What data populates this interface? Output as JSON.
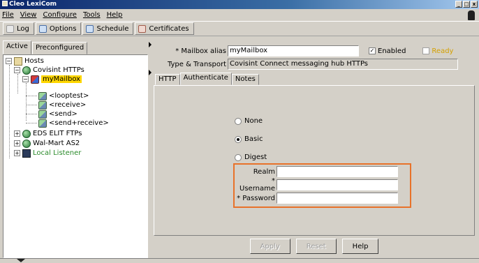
{
  "window": {
    "title": "Cleo LexiCom",
    "min": "_",
    "max": "□",
    "close": "x"
  },
  "menu": [
    "File",
    "View",
    "Configure",
    "Tools",
    "Help"
  ],
  "toolbar": {
    "log": "Log",
    "options": "Options",
    "schedule": "Schedule",
    "certificates": "Certificates"
  },
  "left_tabs": {
    "active": "Active",
    "preconfigured": "Preconfigured"
  },
  "tree": {
    "hosts": "Hosts",
    "covisint": "Covisint HTTPs",
    "mymailbox": "myMailbox",
    "looptest": "<looptest>",
    "receive": "<receive>",
    "send": "<send>",
    "sendreceive": "<send+receive>",
    "eds": "EDS ELIT FTPs",
    "walmart": "Wal-Mart AS2",
    "local_listener": "Local Listener",
    "expand_minus": "−",
    "expand_plus": "+"
  },
  "form": {
    "mailbox_alias_label": "* Mailbox alias",
    "mailbox_alias_value": "myMailbox",
    "enabled_label": "Enabled",
    "enabled_check": "✓",
    "ready_label": "Ready",
    "type_label": "Type & Transport",
    "type_value": "Covisint Connect messaging hub HTTPs"
  },
  "tabs": {
    "http": "HTTP",
    "authenticate": "Authenticate",
    "notes": "Notes"
  },
  "auth": {
    "none": "None",
    "basic": "Basic",
    "digest": "Digest",
    "selected": "Basic",
    "realm_label": "Realm",
    "username_label": "* Username",
    "password_label": "* Password",
    "realm_value": "",
    "username_value": "",
    "password_value": ""
  },
  "buttons": {
    "apply": "Apply",
    "reset": "Reset",
    "help": "Help"
  },
  "colors": {
    "highlight_box": "#e8722a",
    "selected_node": "#ffd700",
    "local_listener": "#2a8a2a"
  }
}
